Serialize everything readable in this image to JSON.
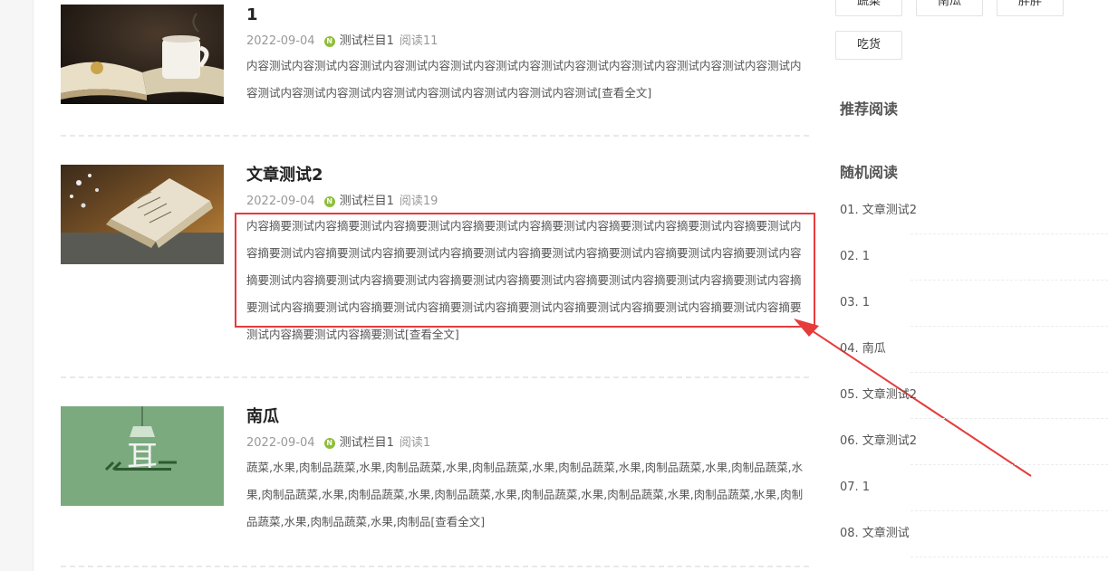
{
  "articles": [
    {
      "title": "1",
      "date": "2022-09-04",
      "category": "测试栏目1",
      "reads": "阅读11",
      "summary": "内容测试内容测试内容测试内容测试内容测试内容测试内容测试内容测试内容测试内容测试内容测试内容测试内容测试内容测试内容测试内容测试内容测试内容测试内容测试内容测试",
      "more": "[查看全文]"
    },
    {
      "title": "文章测试2",
      "date": "2022-09-04",
      "category": "测试栏目1",
      "reads": "阅读19",
      "summary": "内容摘要测试内容摘要测试内容摘要测试内容摘要测试内容摘要测试内容摘要测试内容摘要测试内容摘要测试内容摘要测试内容摘要测试内容摘要测试内容摘要测试内容摘要测试内容摘要测试内容摘要测试内容摘要测试内容摘要测试内容摘要测试内容摘要测试内容摘要测试内容摘要测试内容摘要测试内容摘要测试内容摘要测试内容摘要测试内容摘要测试内容摘要测试内容摘要测试内容摘要测试内容摘要测试内容摘要测试内容摘要测试内容摘要测试内容摘要测试内容摘要测试",
      "more": "[查看全文]"
    },
    {
      "title": "南瓜",
      "date": "2022-09-04",
      "category": "测试栏目1",
      "reads": "阅读1",
      "summary": "蔬菜,水果,肉制品蔬菜,水果,肉制品蔬菜,水果,肉制品蔬菜,水果,肉制品蔬菜,水果,肉制品蔬菜,水果,肉制品蔬菜,水果,肉制品蔬菜,水果,肉制品蔬菜,水果,肉制品蔬菜,水果,肉制品蔬菜,水果,肉制品蔬菜,水果,肉制品蔬菜,水果,肉制品蔬菜,水果,肉制品蔬菜,水果,肉制品",
      "more": "[查看全文]"
    }
  ],
  "thumb3_text": "耳",
  "tags": [
    "蔬菜",
    "南瓜",
    "胖胖",
    "吃货"
  ],
  "sidebar": {
    "recommend_title": "推荐阅读",
    "random_title": "随机阅读",
    "random_items": [
      "01. 文章测试2",
      "02. 1",
      "03. 1",
      "04. 南瓜",
      "05. 文章测试2",
      "06. 文章测试2",
      "07. 1",
      "08. 文章测试"
    ]
  },
  "colors": {
    "highlight": "#e63b3b",
    "category_icon": "#8fbf3a",
    "thumb3_bg": "#7aaa7e"
  }
}
